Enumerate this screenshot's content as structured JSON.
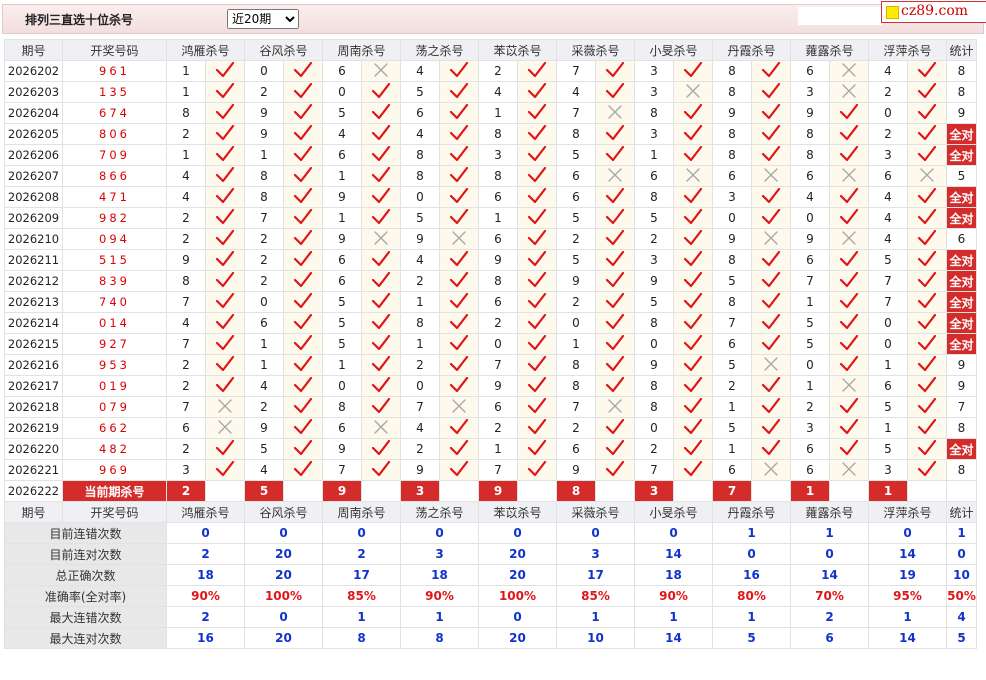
{
  "header": {
    "title": "排列三直选十位杀号",
    "period_select": "近20期",
    "period_options": [
      "近20期"
    ]
  },
  "logo": {
    "text": "cz89.com"
  },
  "columns": [
    "期号",
    "开奖号码",
    "鸿雁杀号",
    "谷风杀号",
    "周南杀号",
    "荡之杀号",
    "苯苡杀号",
    "采薇杀号",
    "小旻杀号",
    "丹霞杀号",
    "蕹露杀号",
    "浮萍杀号",
    "统计"
  ],
  "rows": [
    {
      "qi": "2026202",
      "win": "961",
      "k": [
        [
          "1",
          "y"
        ],
        [
          "0",
          "y"
        ],
        [
          "6",
          "n"
        ],
        [
          "4",
          "y"
        ],
        [
          "2",
          "y"
        ],
        [
          "7",
          "y"
        ],
        [
          "3",
          "y"
        ],
        [
          "8",
          "y"
        ],
        [
          "6",
          "n"
        ],
        [
          "4",
          "y"
        ]
      ],
      "total": "8"
    },
    {
      "qi": "2026203",
      "win": "135",
      "k": [
        [
          "1",
          "y"
        ],
        [
          "2",
          "y"
        ],
        [
          "0",
          "y"
        ],
        [
          "5",
          "y"
        ],
        [
          "4",
          "y"
        ],
        [
          "4",
          "y"
        ],
        [
          "3",
          "n"
        ],
        [
          "8",
          "y"
        ],
        [
          "3",
          "n"
        ],
        [
          "2",
          "y"
        ]
      ],
      "total": "8"
    },
    {
      "qi": "2026204",
      "win": "674",
      "k": [
        [
          "8",
          "y"
        ],
        [
          "9",
          "y"
        ],
        [
          "5",
          "y"
        ],
        [
          "6",
          "y"
        ],
        [
          "1",
          "y"
        ],
        [
          "7",
          "n"
        ],
        [
          "8",
          "y"
        ],
        [
          "9",
          "y"
        ],
        [
          "9",
          "y"
        ],
        [
          "0",
          "y"
        ]
      ],
      "total": "9"
    },
    {
      "qi": "2026205",
      "win": "806",
      "k": [
        [
          "2",
          "y"
        ],
        [
          "9",
          "y"
        ],
        [
          "4",
          "y"
        ],
        [
          "4",
          "y"
        ],
        [
          "8",
          "y"
        ],
        [
          "8",
          "y"
        ],
        [
          "3",
          "y"
        ],
        [
          "8",
          "y"
        ],
        [
          "8",
          "y"
        ],
        [
          "2",
          "y"
        ]
      ],
      "total": "全对"
    },
    {
      "qi": "2026206",
      "win": "709",
      "k": [
        [
          "1",
          "y"
        ],
        [
          "1",
          "y"
        ],
        [
          "6",
          "y"
        ],
        [
          "8",
          "y"
        ],
        [
          "3",
          "y"
        ],
        [
          "5",
          "y"
        ],
        [
          "1",
          "y"
        ],
        [
          "8",
          "y"
        ],
        [
          "8",
          "y"
        ],
        [
          "3",
          "y"
        ]
      ],
      "total": "全对"
    },
    {
      "qi": "2026207",
      "win": "866",
      "k": [
        [
          "4",
          "y"
        ],
        [
          "8",
          "y"
        ],
        [
          "1",
          "y"
        ],
        [
          "8",
          "y"
        ],
        [
          "8",
          "y"
        ],
        [
          "6",
          "n"
        ],
        [
          "6",
          "n"
        ],
        [
          "6",
          "n"
        ],
        [
          "6",
          "n"
        ],
        [
          "6",
          "n"
        ]
      ],
      "total": "5"
    },
    {
      "qi": "2026208",
      "win": "471",
      "k": [
        [
          "4",
          "y"
        ],
        [
          "8",
          "y"
        ],
        [
          "9",
          "y"
        ],
        [
          "0",
          "y"
        ],
        [
          "6",
          "y"
        ],
        [
          "6",
          "y"
        ],
        [
          "8",
          "y"
        ],
        [
          "3",
          "y"
        ],
        [
          "4",
          "y"
        ],
        [
          "4",
          "y"
        ]
      ],
      "total": "全对"
    },
    {
      "qi": "2026209",
      "win": "982",
      "k": [
        [
          "2",
          "y"
        ],
        [
          "7",
          "y"
        ],
        [
          "1",
          "y"
        ],
        [
          "5",
          "y"
        ],
        [
          "1",
          "y"
        ],
        [
          "5",
          "y"
        ],
        [
          "5",
          "y"
        ],
        [
          "0",
          "y"
        ],
        [
          "0",
          "y"
        ],
        [
          "4",
          "y"
        ]
      ],
      "total": "全对"
    },
    {
      "qi": "2026210",
      "win": "094",
      "k": [
        [
          "2",
          "y"
        ],
        [
          "2",
          "y"
        ],
        [
          "9",
          "n"
        ],
        [
          "9",
          "n"
        ],
        [
          "6",
          "y"
        ],
        [
          "2",
          "y"
        ],
        [
          "2",
          "y"
        ],
        [
          "9",
          "n"
        ],
        [
          "9",
          "n"
        ],
        [
          "4",
          "y"
        ]
      ],
      "total": "6"
    },
    {
      "qi": "2026211",
      "win": "515",
      "k": [
        [
          "9",
          "y"
        ],
        [
          "2",
          "y"
        ],
        [
          "6",
          "y"
        ],
        [
          "4",
          "y"
        ],
        [
          "9",
          "y"
        ],
        [
          "5",
          "y"
        ],
        [
          "3",
          "y"
        ],
        [
          "8",
          "y"
        ],
        [
          "6",
          "y"
        ],
        [
          "5",
          "y"
        ]
      ],
      "total": "全对"
    },
    {
      "qi": "2026212",
      "win": "839",
      "k": [
        [
          "8",
          "y"
        ],
        [
          "2",
          "y"
        ],
        [
          "6",
          "y"
        ],
        [
          "2",
          "y"
        ],
        [
          "8",
          "y"
        ],
        [
          "9",
          "y"
        ],
        [
          "9",
          "y"
        ],
        [
          "5",
          "y"
        ],
        [
          "7",
          "y"
        ],
        [
          "7",
          "y"
        ]
      ],
      "total": "全对"
    },
    {
      "qi": "2026213",
      "win": "740",
      "k": [
        [
          "7",
          "y"
        ],
        [
          "0",
          "y"
        ],
        [
          "5",
          "y"
        ],
        [
          "1",
          "y"
        ],
        [
          "6",
          "y"
        ],
        [
          "2",
          "y"
        ],
        [
          "5",
          "y"
        ],
        [
          "8",
          "y"
        ],
        [
          "1",
          "y"
        ],
        [
          "7",
          "y"
        ]
      ],
      "total": "全对"
    },
    {
      "qi": "2026214",
      "win": "014",
      "k": [
        [
          "4",
          "y"
        ],
        [
          "6",
          "y"
        ],
        [
          "5",
          "y"
        ],
        [
          "8",
          "y"
        ],
        [
          "2",
          "y"
        ],
        [
          "0",
          "y"
        ],
        [
          "8",
          "y"
        ],
        [
          "7",
          "y"
        ],
        [
          "5",
          "y"
        ],
        [
          "0",
          "y"
        ]
      ],
      "total": "全对"
    },
    {
      "qi": "2026215",
      "win": "927",
      "k": [
        [
          "7",
          "y"
        ],
        [
          "1",
          "y"
        ],
        [
          "5",
          "y"
        ],
        [
          "1",
          "y"
        ],
        [
          "0",
          "y"
        ],
        [
          "1",
          "y"
        ],
        [
          "0",
          "y"
        ],
        [
          "6",
          "y"
        ],
        [
          "5",
          "y"
        ],
        [
          "0",
          "y"
        ]
      ],
      "total": "全对"
    },
    {
      "qi": "2026216",
      "win": "953",
      "k": [
        [
          "2",
          "y"
        ],
        [
          "1",
          "y"
        ],
        [
          "1",
          "y"
        ],
        [
          "2",
          "y"
        ],
        [
          "7",
          "y"
        ],
        [
          "8",
          "y"
        ],
        [
          "9",
          "y"
        ],
        [
          "5",
          "n"
        ],
        [
          "0",
          "y"
        ],
        [
          "1",
          "y"
        ]
      ],
      "total": "9"
    },
    {
      "qi": "2026217",
      "win": "019",
      "k": [
        [
          "2",
          "y"
        ],
        [
          "4",
          "y"
        ],
        [
          "0",
          "y"
        ],
        [
          "0",
          "y"
        ],
        [
          "9",
          "y"
        ],
        [
          "8",
          "y"
        ],
        [
          "8",
          "y"
        ],
        [
          "2",
          "y"
        ],
        [
          "1",
          "n"
        ],
        [
          "6",
          "y"
        ]
      ],
      "total": "9"
    },
    {
      "qi": "2026218",
      "win": "079",
      "k": [
        [
          "7",
          "n"
        ],
        [
          "2",
          "y"
        ],
        [
          "8",
          "y"
        ],
        [
          "7",
          "n"
        ],
        [
          "6",
          "y"
        ],
        [
          "7",
          "n"
        ],
        [
          "8",
          "y"
        ],
        [
          "1",
          "y"
        ],
        [
          "2",
          "y"
        ],
        [
          "5",
          "y"
        ]
      ],
      "total": "7"
    },
    {
      "qi": "2026219",
      "win": "662",
      "k": [
        [
          "6",
          "n"
        ],
        [
          "9",
          "y"
        ],
        [
          "6",
          "n"
        ],
        [
          "4",
          "y"
        ],
        [
          "2",
          "y"
        ],
        [
          "2",
          "y"
        ],
        [
          "0",
          "y"
        ],
        [
          "5",
          "y"
        ],
        [
          "3",
          "y"
        ],
        [
          "1",
          "y"
        ]
      ],
      "total": "8"
    },
    {
      "qi": "2026220",
      "win": "482",
      "k": [
        [
          "2",
          "y"
        ],
        [
          "5",
          "y"
        ],
        [
          "9",
          "y"
        ],
        [
          "2",
          "y"
        ],
        [
          "1",
          "y"
        ],
        [
          "6",
          "y"
        ],
        [
          "2",
          "y"
        ],
        [
          "1",
          "y"
        ],
        [
          "6",
          "y"
        ],
        [
          "5",
          "y"
        ]
      ],
      "total": "全对"
    },
    {
      "qi": "2026221",
      "win": "969",
      "k": [
        [
          "3",
          "y"
        ],
        [
          "4",
          "y"
        ],
        [
          "7",
          "y"
        ],
        [
          "9",
          "y"
        ],
        [
          "7",
          "y"
        ],
        [
          "9",
          "y"
        ],
        [
          "7",
          "y"
        ],
        [
          "6",
          "n"
        ],
        [
          "6",
          "n"
        ],
        [
          "3",
          "y"
        ]
      ],
      "total": "8"
    }
  ],
  "current": {
    "qi": "2026222",
    "label": "当前期杀号",
    "kills": [
      "2",
      "5",
      "9",
      "3",
      "9",
      "8",
      "3",
      "7",
      "1",
      "1"
    ]
  },
  "stats": [
    {
      "label": "目前连错次数",
      "vals": [
        "0",
        "0",
        "0",
        "0",
        "0",
        "0",
        "0",
        "1",
        "1",
        "0"
      ],
      "total": "1",
      "red": false
    },
    {
      "label": "目前连对次数",
      "vals": [
        "2",
        "20",
        "2",
        "3",
        "20",
        "3",
        "14",
        "0",
        "0",
        "14"
      ],
      "total": "0",
      "red": false
    },
    {
      "label": "总正确次数",
      "vals": [
        "18",
        "20",
        "17",
        "18",
        "20",
        "17",
        "18",
        "16",
        "14",
        "19"
      ],
      "total": "10",
      "red": false
    },
    {
      "label": "准确率(全对率)",
      "vals": [
        "90%",
        "100%",
        "85%",
        "90%",
        "100%",
        "85%",
        "90%",
        "80%",
        "70%",
        "95%"
      ],
      "total": "50%",
      "red": true
    },
    {
      "label": "最大连错次数",
      "vals": [
        "2",
        "0",
        "1",
        "1",
        "0",
        "1",
        "1",
        "1",
        "2",
        "1"
      ],
      "total": "4",
      "red": false
    },
    {
      "label": "最大连对次数",
      "vals": [
        "16",
        "20",
        "8",
        "8",
        "20",
        "10",
        "14",
        "5",
        "6",
        "14"
      ],
      "total": "5",
      "red": false
    }
  ],
  "colors": {
    "accent_red": "#d42b2b",
    "check": "#e01616",
    "cross": "#b0b0b0",
    "stat_blue": "#1133cc",
    "row_alt": "#fdf9ec"
  }
}
